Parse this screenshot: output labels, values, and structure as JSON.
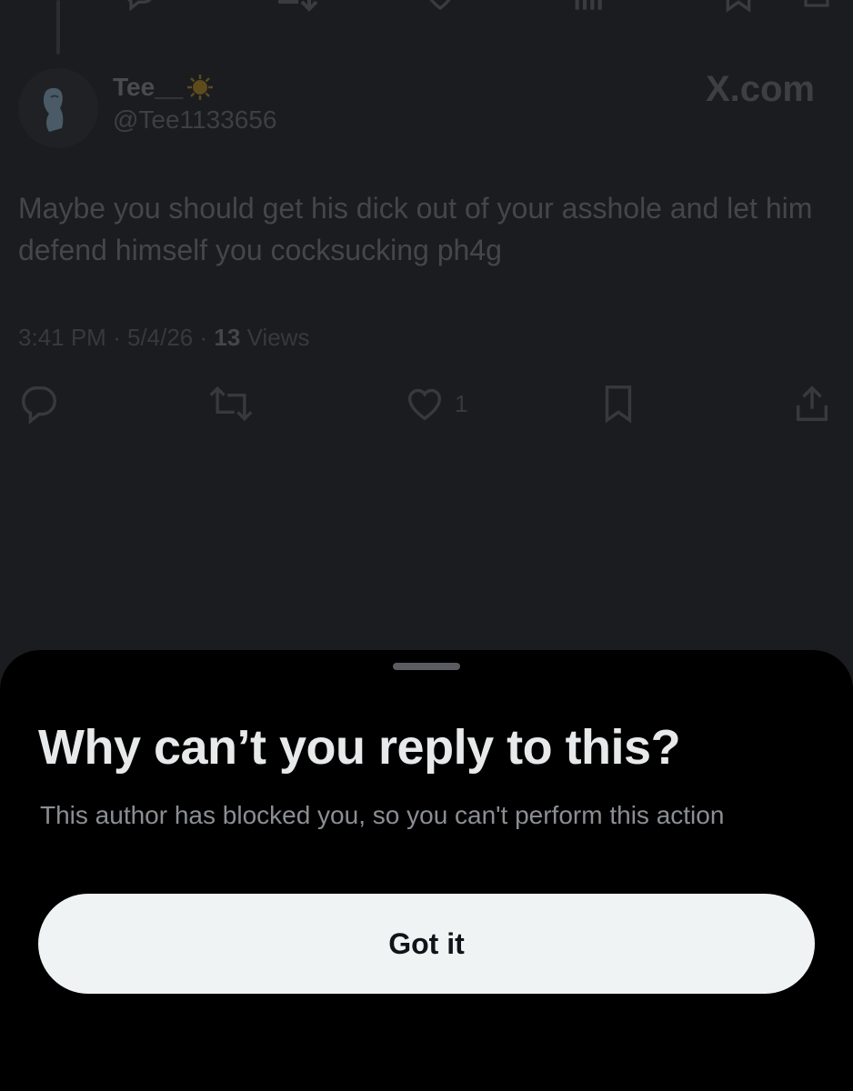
{
  "tweet": {
    "display_name": "Tee__",
    "name_emoji": "🌞",
    "handle": "@Tee1133656",
    "source": "X.com",
    "text": "Maybe you should get his dick out of your asshole and let him defend himself you cocksucking ph4g",
    "time": "3:41 PM",
    "separator": "·",
    "date": "5/4/26",
    "views_count": "13",
    "views_label": "Views",
    "likes_count": "1"
  },
  "icons": {
    "reply": "reply-icon",
    "repost": "repost-icon",
    "like": "heart-icon",
    "bookmark": "bookmark-icon",
    "share": "share-icon"
  },
  "sheet": {
    "title": "Why can’t you reply to this?",
    "body": "This author has blocked you, so you can't perform this action",
    "button_label": "Got it"
  },
  "colors": {
    "background": "#1b1c1f",
    "sheet_background": "#000000",
    "button_background": "#eff3f4",
    "title_text": "#e7e9ea",
    "body_text": "#8b8e93"
  }
}
